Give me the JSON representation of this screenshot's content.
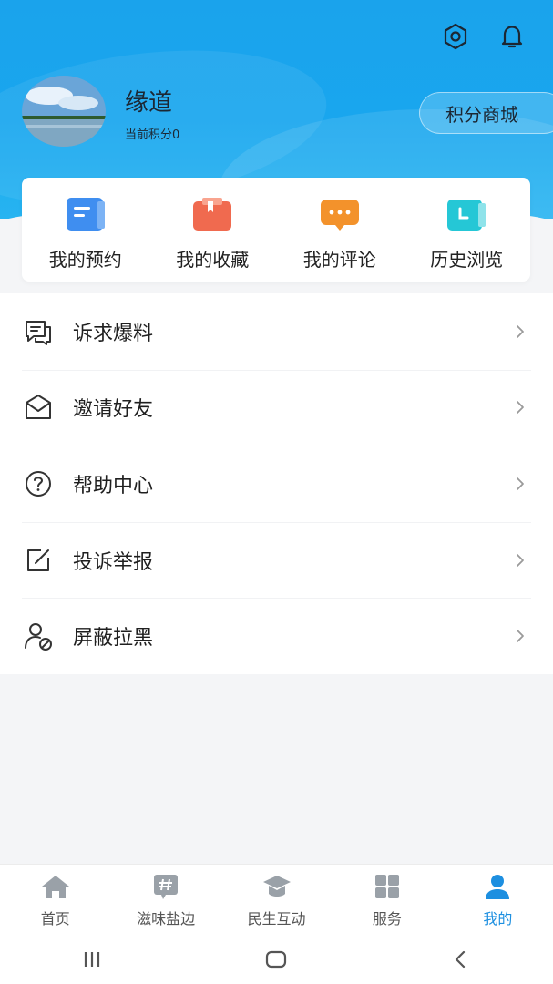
{
  "profile": {
    "name": "缘道",
    "points": "当前积分0",
    "mall_button": "积分商城"
  },
  "quick_actions": [
    {
      "label": "我的预约",
      "icon": "appointment-icon",
      "color": "#3f8ef0"
    },
    {
      "label": "我的收藏",
      "icon": "favorites-icon",
      "color": "#f06a4f"
    },
    {
      "label": "我的评论",
      "icon": "comment-icon",
      "color": "#f3922b"
    },
    {
      "label": "历史浏览",
      "icon": "history-icon",
      "color": "#25c7d6"
    }
  ],
  "menu": [
    {
      "label": "诉求爆料",
      "icon": "chat-report-icon"
    },
    {
      "label": "邀请好友",
      "icon": "envelope-icon"
    },
    {
      "label": "帮助中心",
      "icon": "question-icon"
    },
    {
      "label": "投诉举报",
      "icon": "edit-icon"
    },
    {
      "label": "屏蔽拉黑",
      "icon": "block-user-icon"
    }
  ],
  "tabs": [
    {
      "label": "首页",
      "icon": "home-icon"
    },
    {
      "label": "滋味盐边",
      "icon": "hashtag-icon"
    },
    {
      "label": "民生互动",
      "icon": "mortarboard-icon"
    },
    {
      "label": "服务",
      "icon": "grid-icon"
    },
    {
      "label": "我的",
      "icon": "person-icon",
      "active": true
    }
  ],
  "colors": {
    "header": "#1aa3ec",
    "active_tab": "#1d8fe0",
    "inactive_icon": "#9aa1a8"
  }
}
